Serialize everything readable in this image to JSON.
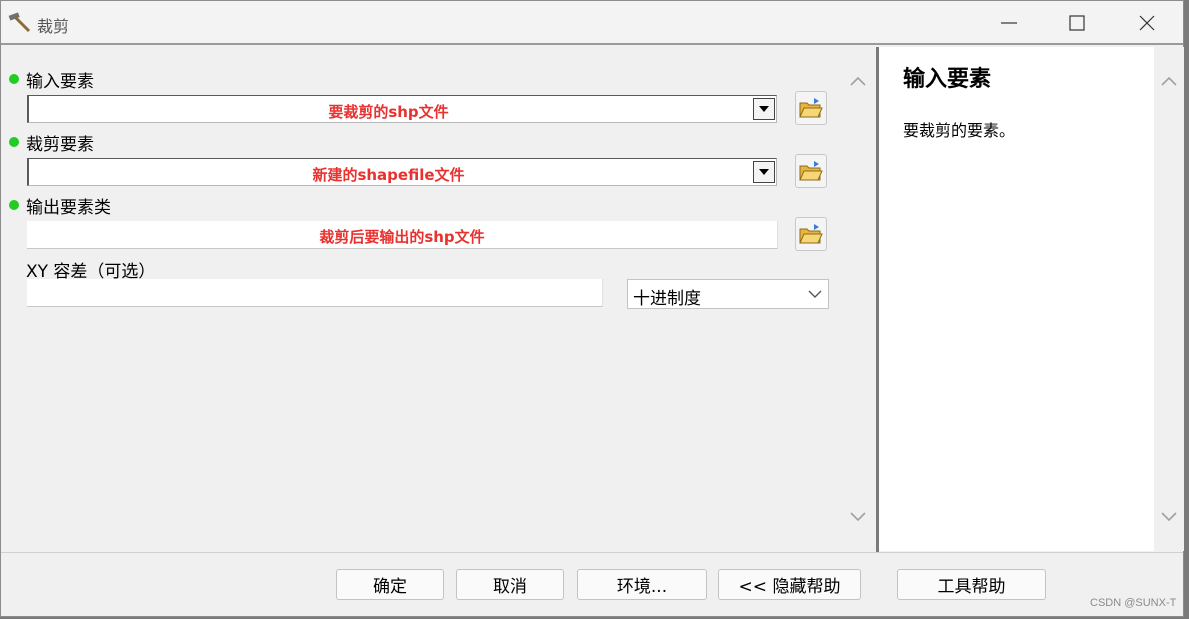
{
  "window": {
    "title": "裁剪",
    "controls": [
      "minimize-icon",
      "maximize-icon",
      "close-icon"
    ]
  },
  "form": {
    "input_features": {
      "label": "输入要素",
      "value": "要裁剪的shp文件",
      "required": true
    },
    "clip_features": {
      "label": "裁剪要素",
      "value": "新建的shapefile文件",
      "required": true
    },
    "output_feature_class": {
      "label": "输出要素类",
      "value": "裁剪后要输出的shp文件",
      "required": true
    },
    "xy_tolerance": {
      "label": "XY 容差（可选）",
      "value": "",
      "unit": "十进制度"
    }
  },
  "help": {
    "title": "输入要素",
    "body": "要裁剪的要素。"
  },
  "buttons": {
    "ok": "确定",
    "cancel": "取消",
    "environments": "环境...",
    "hide_help": "<< 隐藏帮助",
    "tool_help": "工具帮助"
  },
  "watermark": "CSDN @SUNX-T",
  "colors": {
    "required_dot": "#22cc22",
    "annotation_text": "#e8322f",
    "folder": "#f2c84b"
  }
}
